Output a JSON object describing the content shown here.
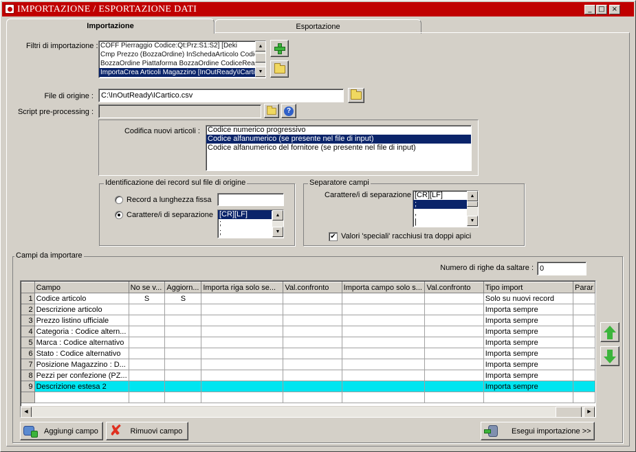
{
  "window": {
    "title": "IMPORTAZIONE / ESPORTAZIONE DATI",
    "min": "_",
    "max": "□",
    "close": "×"
  },
  "tabs": [
    {
      "label": "Importazione"
    },
    {
      "label": "Esportazione"
    }
  ],
  "filters": {
    "label": "Filtri di importazione :",
    "items": [
      "COFF Pierraggio       Codice:Qt:Prz:S1:S2]  [Deki",
      "Cmp Prezzo (BozzaOrdine)   InSchedaArticolo  Codice;Ca",
      "BozzaOrdine  Piattaforma  BozzaOrdine  CodiceReady;",
      "ImportaCrea Articoli Magazzino [InOutReady\\ICartic"
    ]
  },
  "file": {
    "label": "File di origine :",
    "value": "C:\\InOutReady\\ICartico.csv"
  },
  "script": {
    "label": "Script pre-processing :",
    "value": ""
  },
  "codifica": {
    "label": "Codifica nuovi articoli :",
    "options": [
      "Codice numerico progressivo",
      "Codice alfanumerico (se presente nel file di input)",
      "Codice alfanumerico del fornitore (se presente nel file di input)"
    ]
  },
  "ident": {
    "title": "Identificazione dei record sul file di origine",
    "radio1": "Record a lunghezza fissa",
    "radio2": "Carattere/i di separazione",
    "listItems": [
      "[CR][LF]",
      ";",
      ";"
    ]
  },
  "sep": {
    "title": "Separatore campi",
    "label": "Carattere/i di separazione",
    "listItems": [
      "[CR][LF]",
      ";",
      ",",
      "|"
    ],
    "checkbox": "Valori 'speciali' racchiusi tra doppi apici",
    "checkMark": "✔"
  },
  "campi": {
    "title": "Campi da importare",
    "skipLabel": "Numero di righe da saltare  :",
    "skipValue": "0",
    "columns": [
      "Campo",
      "No se v...",
      "Aggiorn...",
      "Importa riga solo se...",
      "Val.confronto",
      "Importa campo solo s...",
      "Val.confronto",
      "Tipo import",
      "Parar"
    ],
    "rows": [
      {
        "n": "1",
        "campo": "Codice articolo",
        "nosev": "S",
        "agg": "S",
        "tipo": "Solo su nuovi record"
      },
      {
        "n": "2",
        "campo": "Descrizione articolo",
        "nosev": "",
        "agg": "",
        "tipo": "Importa sempre"
      },
      {
        "n": "3",
        "campo": "Prezzo listino ufficiale",
        "nosev": "",
        "agg": "",
        "tipo": "Importa sempre"
      },
      {
        "n": "4",
        "campo": "Categoria : Codice altern...",
        "nosev": "",
        "agg": "",
        "tipo": "Importa sempre"
      },
      {
        "n": "5",
        "campo": "Marca : Codice alternativo",
        "nosev": "",
        "agg": "",
        "tipo": "Importa sempre"
      },
      {
        "n": "6",
        "campo": "Stato : Codice alternativo",
        "nosev": "",
        "agg": "",
        "tipo": "Importa sempre"
      },
      {
        "n": "7",
        "campo": "Posizione Magazzino : D...",
        "nosev": "",
        "agg": "",
        "tipo": "Importa sempre"
      },
      {
        "n": "8",
        "campo": "Pezzi per confezione (PZ...",
        "nosev": "",
        "agg": "",
        "tipo": "Importa sempre"
      },
      {
        "n": "9",
        "campo": "Descrizione estesa 2",
        "nosev": "",
        "agg": "",
        "tipo": "Importa sempre"
      }
    ]
  },
  "buttons": {
    "add": "Aggiungi campo",
    "remove": "Rimuovi campo",
    "run": "Esegui importazione >>"
  }
}
